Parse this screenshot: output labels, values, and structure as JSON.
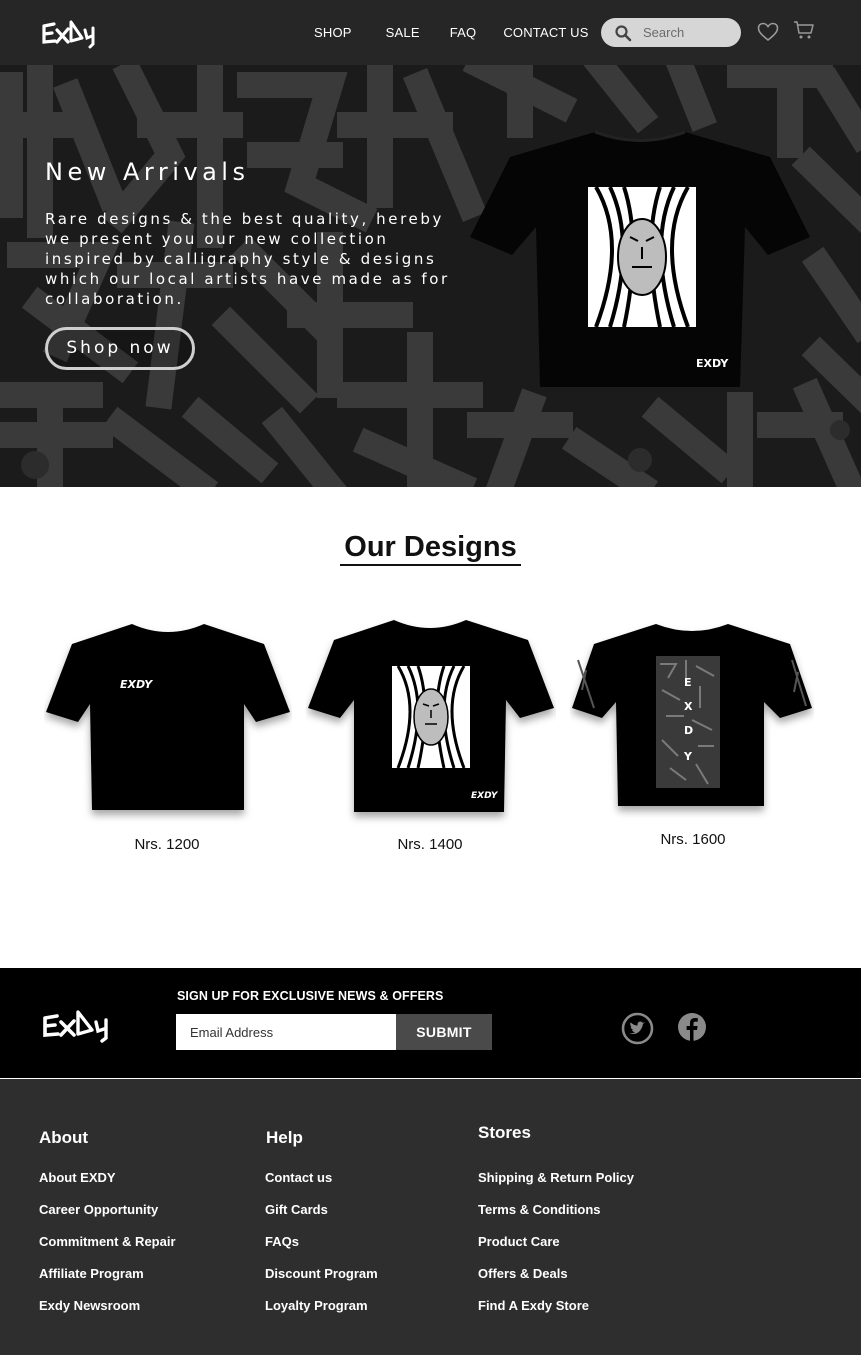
{
  "brand": {
    "logo_icon": "exdy-logo-icon"
  },
  "nav": {
    "links": [
      {
        "label": "SHOP"
      },
      {
        "label": "SALE"
      },
      {
        "label": "FAQ"
      },
      {
        "label": "CONTACT US"
      }
    ],
    "search": {
      "placeholder": "Search",
      "icon": "search-icon"
    },
    "wishlist_icon": "heart-icon",
    "cart_icon": "cart-icon"
  },
  "hero": {
    "title": "New Arrivals",
    "description": "Rare designs & the best quality, hereby we present you our new collection inspired by calligraphy style & designs which our local artists have made as for collaboration.",
    "cta_label": "Shop now"
  },
  "designs": {
    "title": "Our Designs",
    "products": [
      {
        "price": "Nrs. 1200",
        "image": "black-tshirt-small-logo"
      },
      {
        "price": "Nrs. 1400",
        "image": "black-tshirt-face-print"
      },
      {
        "price": "Nrs. 1600",
        "image": "black-tshirt-calligraphy-print"
      }
    ]
  },
  "newsletter": {
    "heading": "SIGN UP FOR EXCLUSIVE NEWS & OFFERS",
    "email_placeholder": "Email Address",
    "submit_label": "SUBMIT",
    "social_icons": [
      "twitter-icon",
      "facebook-icon"
    ]
  },
  "footer": {
    "columns": [
      {
        "title": "About",
        "links": [
          "About EXDY",
          "Career Opportunity",
          "Commitment & Repair",
          "Affiliate Program",
          "Exdy Newsroom"
        ]
      },
      {
        "title": "Help",
        "links": [
          "Contact us",
          "Gift Cards",
          "FAQs",
          "Discount Program",
          "Loyalty Program"
        ]
      },
      {
        "title": "Stores",
        "links": [
          "Shipping & Return Policy",
          "Terms & Conditions",
          "Product Care",
          "Offers & Deals",
          "Find A Exdy Store"
        ]
      }
    ]
  },
  "colors": {
    "nav_bg": "#262626",
    "hero_bg": "#1c1c1c",
    "band_bg": "#000000",
    "footer_bg": "#2e2e2e",
    "submit_bg": "#4a4a4a"
  }
}
